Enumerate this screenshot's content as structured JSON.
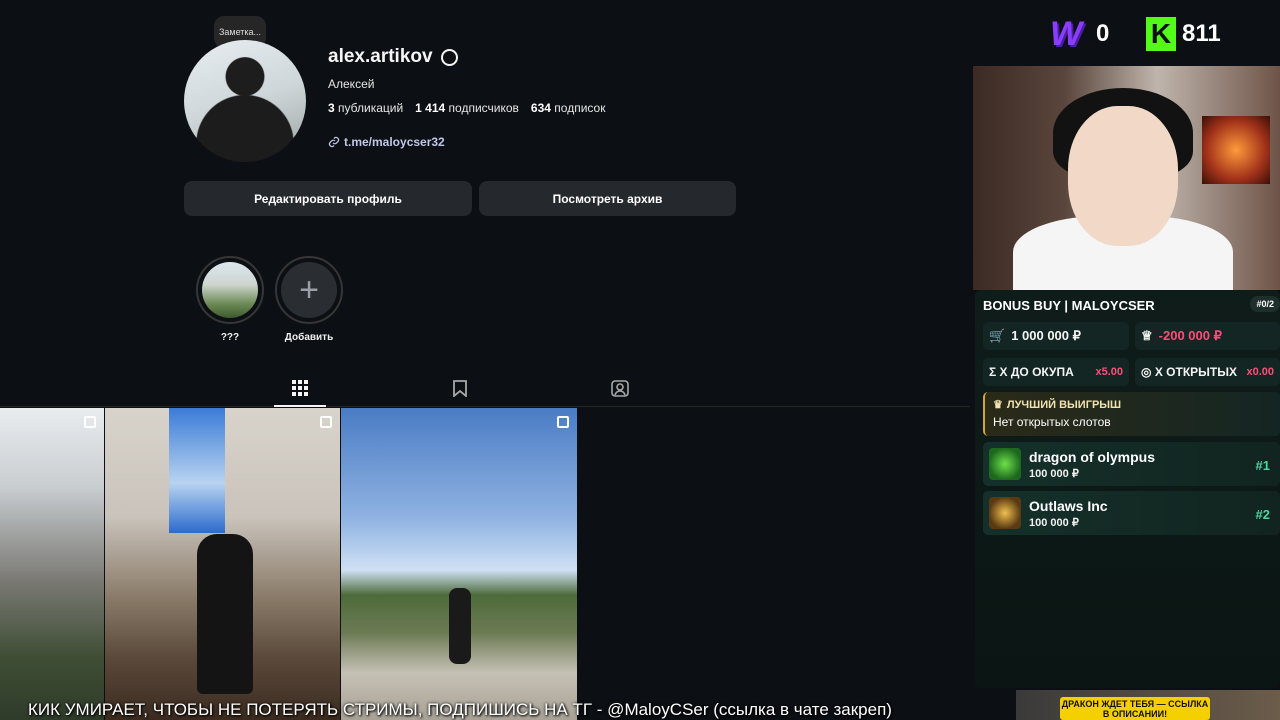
{
  "profile": {
    "note": "Заметка...",
    "username": "alex.artikov",
    "fullname": "Алексей",
    "stats": {
      "posts_count": "3",
      "posts_label": "публикаций",
      "followers_count": "1 414",
      "followers_label": "подписчиков",
      "following_count": "634",
      "following_label": "подписок"
    },
    "link": "t.me/maloycser32",
    "edit_button": "Редактировать профиль",
    "archive_button": "Посмотреть архив",
    "highlights": [
      {
        "label": "???"
      },
      {
        "label": "Добавить",
        "icon": "plus-icon"
      }
    ]
  },
  "stream": {
    "w_count": "0",
    "k_count": "811",
    "bonus": {
      "title": "BONUS BUY | MALOYCSER",
      "counter": "#0/2",
      "cost": "1 000 000 ₽",
      "win": "-200 000 ₽",
      "x_to_payback_label": "X ДО ОКУПА",
      "x_to_payback_value": "x5.00",
      "x_opened_label": "X ОТКРЫТЫХ",
      "x_opened_value": "x0.00",
      "best_title": "ЛУЧШИЙ ВЫИГРЫШ",
      "best_value": "Нет открытых слотов",
      "slots": [
        {
          "name": "dragon of olympus",
          "price": "100 000 ₽",
          "rank": "#1"
        },
        {
          "name": "Outlaws Inc",
          "price": "100 000 ₽",
          "rank": "#2"
        }
      ]
    },
    "promo": "ДРАКОН ЖДЕТ ТЕБЯ — ССЫЛКА В ОПИСАНИИ!",
    "ticker": "КИК УМИРАЕТ, ЧТОБЫ НЕ ПОТЕРЯТЬ СТРИМЫ, ПОДПИШИСЬ НА ТГ - @MaloyCSer (ссылка в чате закреп)"
  },
  "colors": {
    "background": "#0c1014",
    "accent_negative": "#ff4d7a",
    "kick_green": "#53fc18",
    "w_purple": "#8b3dff"
  }
}
